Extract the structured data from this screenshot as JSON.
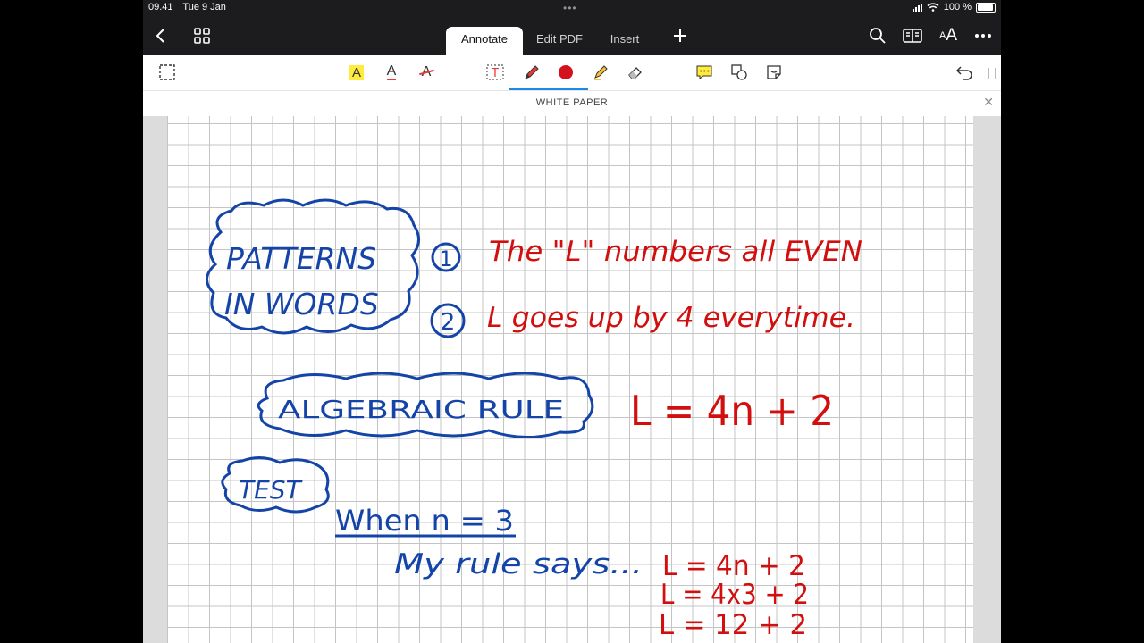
{
  "status_bar": {
    "time": "09.41",
    "date": "Tue 9 Jan",
    "battery": "100 %"
  },
  "top_bar": {
    "tabs": [
      "Annotate",
      "Edit PDF",
      "Insert"
    ],
    "active_tab": "Annotate",
    "icons": [
      "back-icon",
      "grid-icon",
      "add-icon",
      "search-icon",
      "book-icon",
      "text-size-icon",
      "more-icon"
    ]
  },
  "toolbar": {
    "tools": [
      "selection",
      "highlight",
      "underline",
      "strikethrough",
      "text-box",
      "pen",
      "color",
      "highlighter",
      "eraser",
      "comment",
      "shapes",
      "sticker",
      "undo"
    ],
    "selected_tool": "pen",
    "pen_color": "#d4121e"
  },
  "document": {
    "title": "WHITE PAPER"
  },
  "notes": {
    "patterns_heading_line1": "PATTERNS",
    "patterns_heading_line2": "IN WORDS",
    "point1_number": "1",
    "point1_text": "The \"L\" numbers all EVEN",
    "point2_number": "2",
    "point2_text": "L goes up by 4 everytime.",
    "algebra_heading": "ALGEBRAIC RULE",
    "algebra_formula": "L = 4n + 2",
    "test_heading": "TEST",
    "when_text": "When n = 3",
    "rule_says_text": "My rule says...",
    "step1": "L = 4n + 2",
    "step2": "L = 4x3 + 2",
    "step3": "L = 12 + 2"
  },
  "colors": {
    "ink_blue": "#1544a8",
    "ink_red": "#d20f0f",
    "accent": "#1e88e5"
  }
}
